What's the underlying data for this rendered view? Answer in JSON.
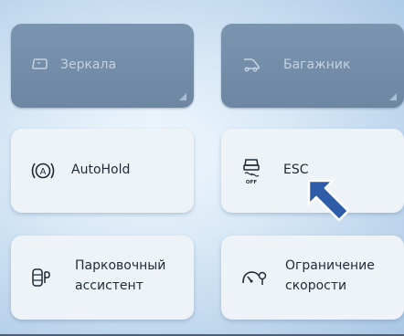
{
  "tiles": {
    "mirrors": {
      "label": "Зеркала",
      "icon": "mirror-icon",
      "state": "inactive"
    },
    "trunk": {
      "label": "Багажник",
      "icon": "trunk-icon",
      "state": "inactive"
    },
    "autohold": {
      "label": "AutoHold",
      "icon": "autohold-icon",
      "state": "active"
    },
    "esc": {
      "label": "ESC",
      "icon": "esc-off-icon",
      "icon_text": "OFF",
      "state": "active"
    },
    "park_assist": {
      "label": "Парковочный\nассистент",
      "icon": "parking-sensor-icon",
      "state": "active"
    },
    "speed_limit": {
      "label": "Ограничение\nскорости",
      "icon": "speed-limiter-icon",
      "state": "active"
    }
  },
  "autohold_icon_text": "A",
  "pointer": {
    "icon": "arrow-pointer-icon",
    "color": "#2f5ca8"
  },
  "colors": {
    "tile_inactive": "#7b95b1",
    "tile_active": "#eef3f8",
    "text_inactive": "#c3d2e2",
    "text_active": "#1f2a36"
  }
}
